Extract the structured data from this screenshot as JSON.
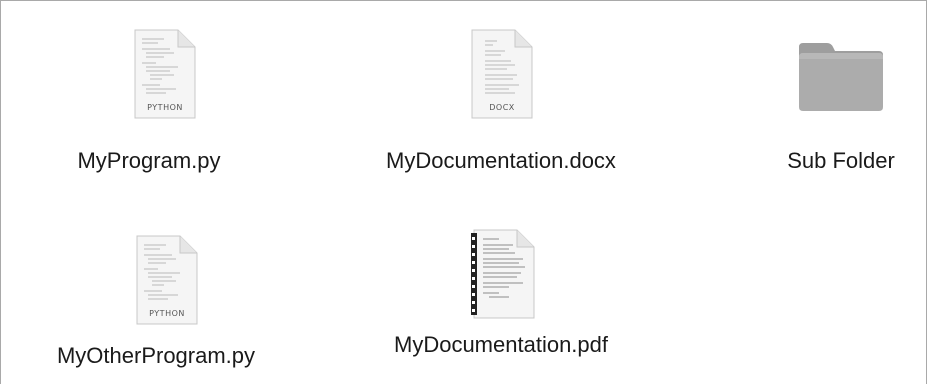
{
  "files": [
    {
      "name": "MyProgram.py",
      "type_label": "PYTHON",
      "kind": "python-file-icon"
    },
    {
      "name": "MyDocumentation.docx",
      "type_label": "DOCX",
      "kind": "docx-file-icon"
    },
    {
      "name": "Sub Folder",
      "kind": "folder-icon"
    },
    {
      "name": "MyOtherProgram.py",
      "type_label": "PYTHON",
      "kind": "python-file-icon"
    },
    {
      "name": "MyDocumentation.pdf",
      "kind": "pdf-file-icon"
    }
  ],
  "colors": {
    "folder": "#a8a8a8",
    "folder_tab": "#9a9a9a",
    "paper": "#f4f4f4",
    "label_text": "#1a1a1a"
  }
}
